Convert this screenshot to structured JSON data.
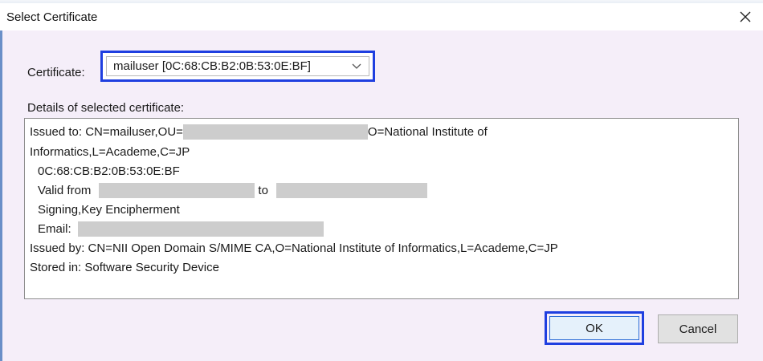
{
  "window": {
    "title": "Select Certificate",
    "close_icon": "close-icon"
  },
  "certificate": {
    "label": "Certificate:",
    "selected": "mailuser [0C:68:CB:B2:0B:53:0E:BF]",
    "dropdown_icon": "chevron-down-icon"
  },
  "details": {
    "label": "Details of selected certificate:",
    "issued_to_prefix": "Issued to: CN=mailuser,OU=",
    "issued_to_suffix": "O=National Institute of",
    "issued_to_line2": "Informatics,L=Academe,C=JP",
    "serial": "0C:68:CB:B2:0B:53:0E:BF",
    "valid_from_label": "Valid from",
    "valid_to_label": "to",
    "usage": "Signing,Key Encipherment",
    "email_label": "Email:",
    "issued_by": "Issued by: CN=NII Open Domain S/MIME CA,O=National Institute of Informatics,L=Academe,C=JP",
    "stored_in": "Stored in: Software Security Device"
  },
  "buttons": {
    "ok": "OK",
    "cancel": "Cancel"
  },
  "colors": {
    "dialog_bg": "#f5eef9",
    "highlight_border": "#1f3fe0",
    "redaction": "#cdcdcd"
  }
}
